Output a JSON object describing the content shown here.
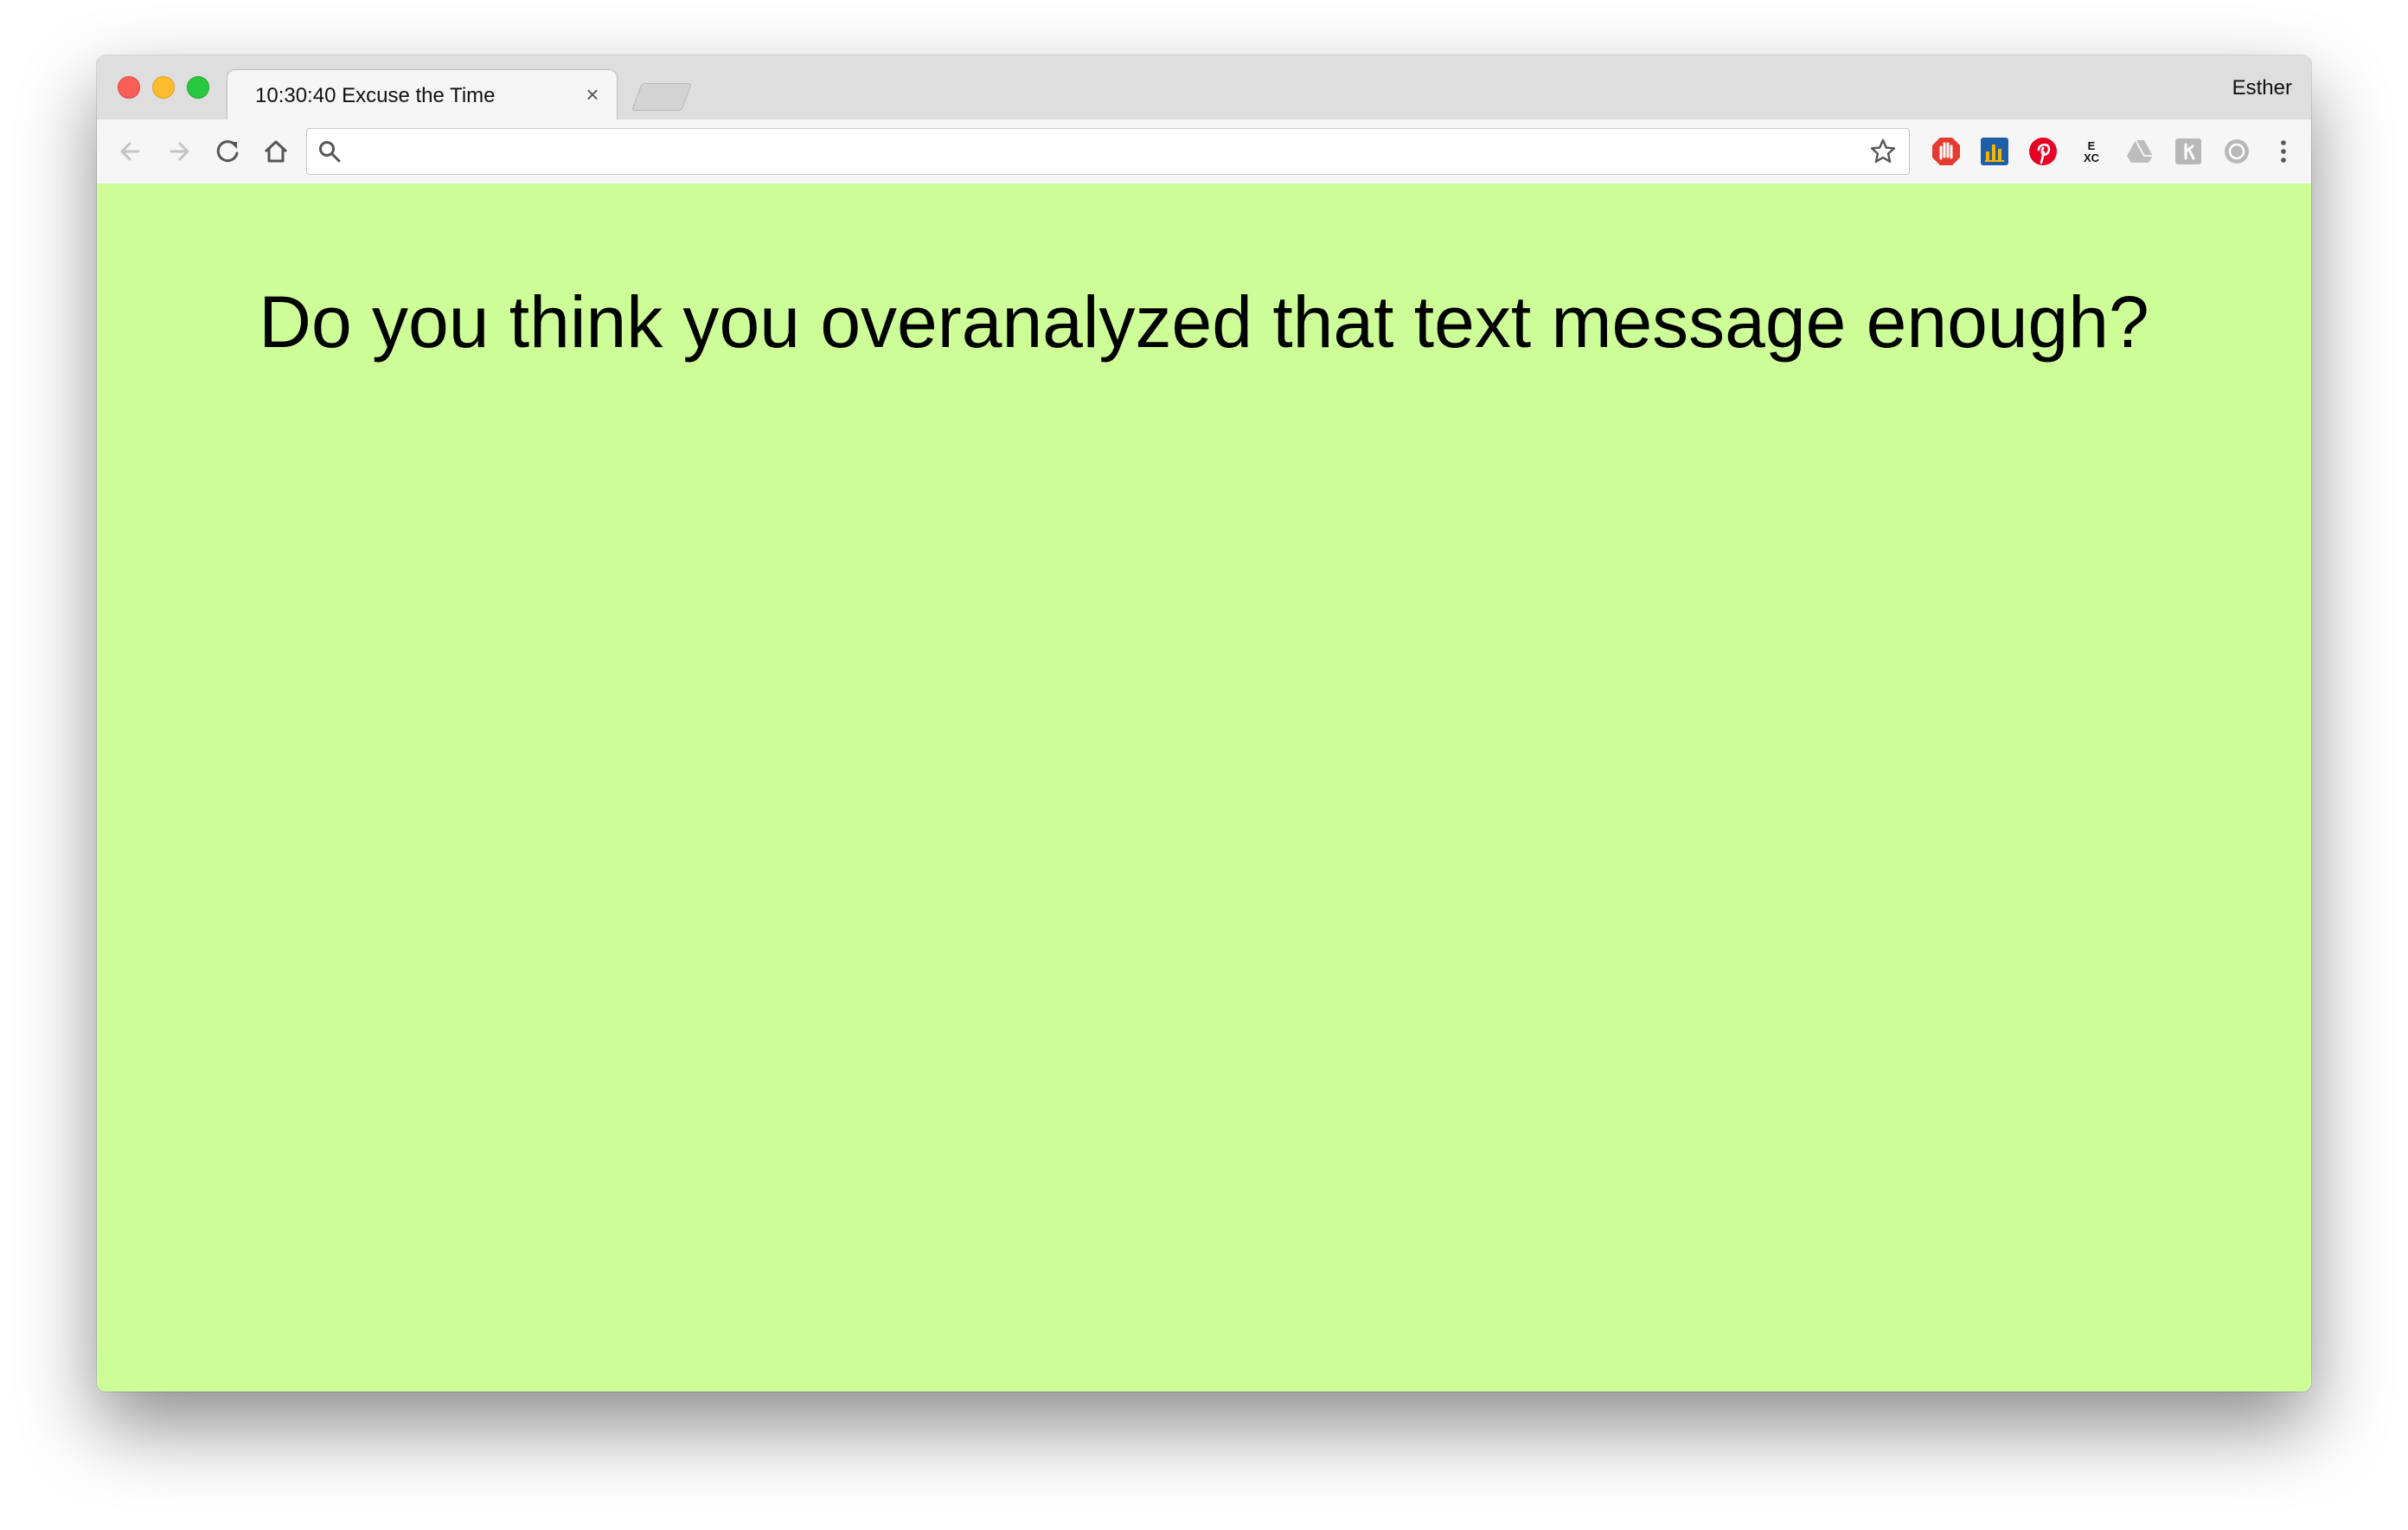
{
  "browser": {
    "tab": {
      "title": "10:30:40 Excuse the Time",
      "close_glyph": "×"
    },
    "profile_name": "Esther",
    "address_bar": {
      "value": "",
      "placeholder": ""
    },
    "toolbar_icons": [
      "back-arrow-icon",
      "forward-arrow-icon",
      "reload-icon",
      "home-icon",
      "search-icon",
      "star-icon"
    ],
    "extensions": [
      "stop-hand-icon",
      "bar-chart-icon",
      "pinterest-icon",
      "exc-icon",
      "drive-icon",
      "extension-icon",
      "sync-icon",
      "menu-dots-icon"
    ]
  },
  "page": {
    "background_color": "#cdfe98",
    "headline": "Do you think you overanalyzed that text message enough?"
  },
  "colors": {
    "close_red": "#fc5f57",
    "minimize_yellow": "#fdbc2e",
    "maximize_green": "#28c840",
    "pinterest_red": "#e60023",
    "stop_red": "#e53a30",
    "chart_blue": "#1f5fa8"
  }
}
